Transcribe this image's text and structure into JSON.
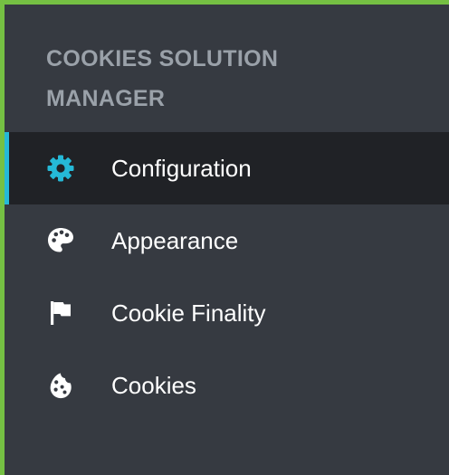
{
  "sidebar": {
    "title_line1": "COOKIES SOLUTION",
    "title_line2": "MANAGER",
    "items": [
      {
        "label": "Configuration",
        "icon": "gear-icon",
        "active": true
      },
      {
        "label": "Appearance",
        "icon": "palette-icon",
        "active": false
      },
      {
        "label": "Cookie Finality",
        "icon": "flag-icon",
        "active": false
      },
      {
        "label": "Cookies",
        "icon": "cookie-icon",
        "active": false
      }
    ]
  },
  "colors": {
    "frame_border": "#75c043",
    "sidebar_bg": "#363a41",
    "active_bg": "#202226",
    "accent": "#25b9d7",
    "title_text": "#9aa1a9",
    "item_text": "#ffffff"
  }
}
